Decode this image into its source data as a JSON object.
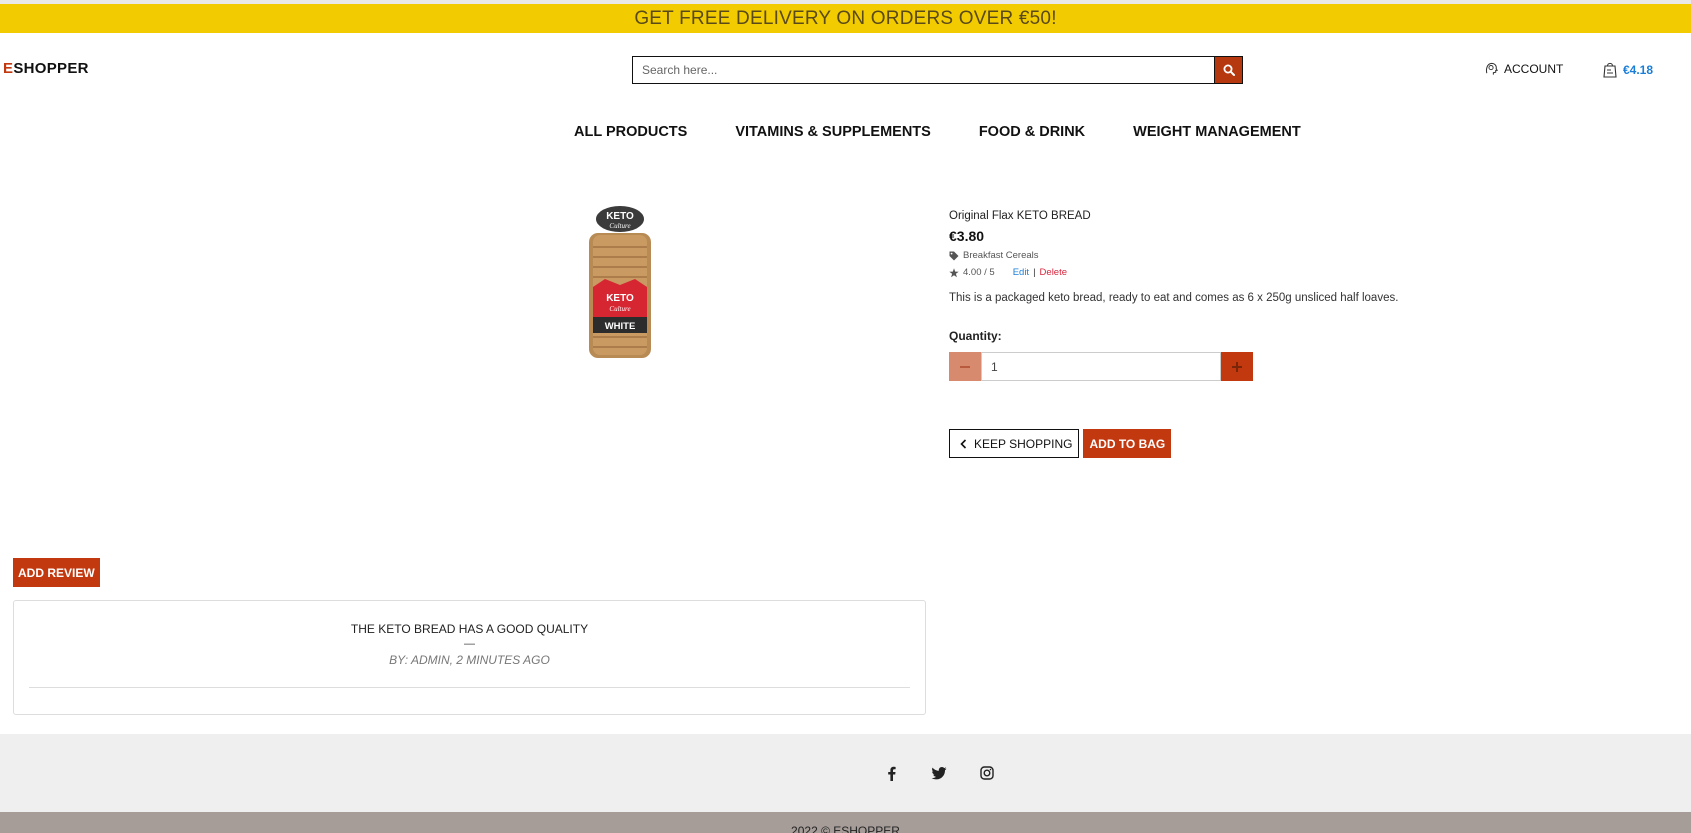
{
  "banner": {
    "text": "GET FREE DELIVERY ON ORDERS OVER €50!"
  },
  "header": {
    "logo_first": "E",
    "logo_rest": "SHOPPER",
    "search_placeholder": "Search here...",
    "account_label": "ACCOUNT",
    "cart_total": "€4.18"
  },
  "nav": {
    "items": [
      {
        "label": "ALL PRODUCTS"
      },
      {
        "label": "VITAMINS & SUPPLEMENTS"
      },
      {
        "label": "FOOD & DRINK"
      },
      {
        "label": "WEIGHT MANAGEMENT"
      }
    ]
  },
  "product": {
    "name": "Original Flax KETO BREAD",
    "price": "€3.80",
    "category": "Breakfast Cereals",
    "rating": "4.00 / 5",
    "edit_label": "Edit",
    "separator": "|",
    "delete_label": "Delete",
    "description": "This is a packaged keto bread, ready to eat and comes as 6 x 250g unsliced half loaves.",
    "quantity_label": "Quantity:",
    "quantity_value": "1",
    "keep_shopping_label": "KEEP SHOPPING",
    "add_to_bag_label": "ADD TO BAG",
    "image_text_top": "KETO",
    "image_text_sub": "Culture",
    "image_text_label": "WHITE"
  },
  "reviews": {
    "add_review_label": "ADD REVIEW",
    "items": [
      {
        "title": "THE KETO BREAD HAS A GOOD QUALITY",
        "dash": "—",
        "by": "BY: ADMIN, 2 MINUTES AGO"
      }
    ]
  },
  "footer": {
    "social": [
      "facebook-icon",
      "twitter-icon",
      "instagram-icon"
    ],
    "copyright": "2022 © ESHOPPER"
  },
  "colors": {
    "banner": "#f2cc00",
    "accent": "#c2380f",
    "link_blue": "#1a7ed8",
    "delete_red": "#d7263d"
  }
}
